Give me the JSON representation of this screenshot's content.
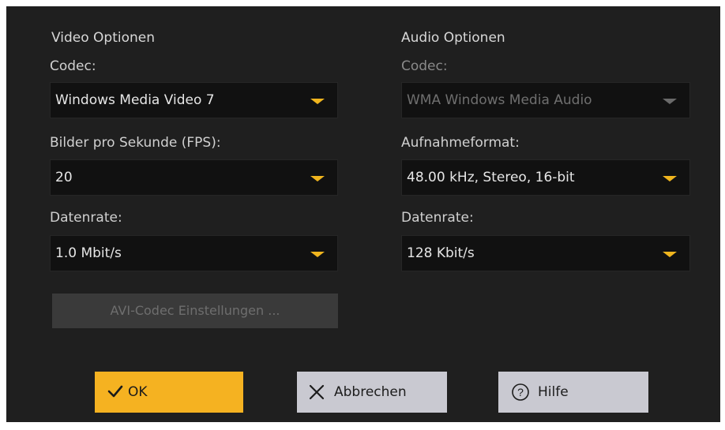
{
  "video": {
    "title": "Video Optionen",
    "codec_label": "Codec:",
    "codec_value": "Windows Media Video 7",
    "fps_label": "Bilder pro Sekunde (FPS):",
    "fps_value": "20",
    "datarate_label": "Datenrate:",
    "datarate_value": "1.0 Mbit/s",
    "avi_button": "AVI-Codec Einstellungen ..."
  },
  "audio": {
    "title": "Audio Optionen",
    "codec_label": "Codec:",
    "codec_value": "WMA Windows Media Audio",
    "format_label": "Aufnahmeformat:",
    "format_value": "48.00 kHz, Stereo, 16-bit",
    "datarate_label": "Datenrate:",
    "datarate_value": "128 Kbit/s"
  },
  "buttons": {
    "ok": "OK",
    "cancel": "Abbrechen",
    "help": "Hilfe"
  },
  "icons": {
    "ok": "checkmark-icon",
    "cancel": "x-icon",
    "help": "question-circle-icon",
    "dropdown": "chevron-down-icon"
  },
  "colors": {
    "accent": "#f5b221",
    "background": "#1f1f1f",
    "field": "#111111"
  }
}
